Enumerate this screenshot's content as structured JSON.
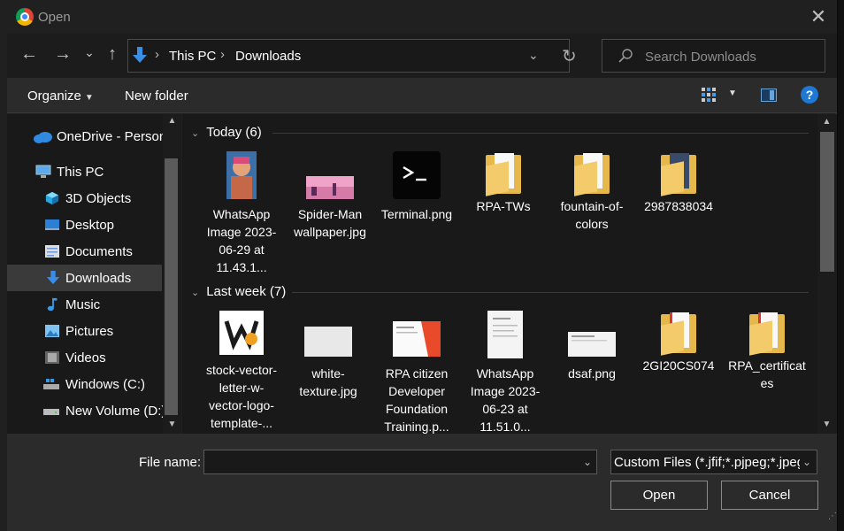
{
  "title_bar": {
    "title": "Open",
    "close_glyph": "✕"
  },
  "nav": {
    "back_glyph": "←",
    "forward_glyph": "→",
    "recent_glyph": "⌄",
    "up_glyph": "↑",
    "breadcrumb": [
      "This PC",
      "Downloads"
    ],
    "refresh_glyph": "↻",
    "search_placeholder": "Search Downloads"
  },
  "command_bar": {
    "organize": "Organize",
    "new_folder": "New folder",
    "help": "?"
  },
  "sidebar": {
    "items": [
      {
        "label": "OneDrive - Person",
        "icon": "cloud-icon"
      },
      {
        "label": "This PC",
        "icon": "computer-icon"
      },
      {
        "label": "3D Objects",
        "icon": "cube-icon"
      },
      {
        "label": "Desktop",
        "icon": "desktop-icon"
      },
      {
        "label": "Documents",
        "icon": "documents-icon"
      },
      {
        "label": "Downloads",
        "icon": "download-arrow-icon",
        "active": true
      },
      {
        "label": "Music",
        "icon": "music-note-icon"
      },
      {
        "label": "Pictures",
        "icon": "pictures-icon"
      },
      {
        "label": "Videos",
        "icon": "film-icon"
      },
      {
        "label": "Windows (C:)",
        "icon": "drive-windows-icon"
      },
      {
        "label": "New Volume (D:)",
        "icon": "drive-icon"
      }
    ]
  },
  "groups": [
    {
      "label": "Today (6)",
      "files": [
        {
          "label": "WhatsApp Image 2023-06-29 at 11.43.1...",
          "kind": "image-portrait"
        },
        {
          "label": "Spider-Man wallpaper.jpg",
          "kind": "image-landscape"
        },
        {
          "label": "Terminal.png",
          "kind": "terminal"
        },
        {
          "label": "RPA-TWs",
          "kind": "folder"
        },
        {
          "label": "fountain-of-colors",
          "kind": "folder"
        },
        {
          "label": "2987838034",
          "kind": "folder-photo"
        }
      ]
    },
    {
      "label": "Last week (7)",
      "files": [
        {
          "label": "stock-vector-letter-w-vector-logo-template-...",
          "kind": "logo"
        },
        {
          "label": "white-texture.jpg",
          "kind": "white"
        },
        {
          "label": "RPA citizen Developer Foundation Training.p...",
          "kind": "certificate"
        },
        {
          "label": "WhatsApp Image 2023-06-23 at 11.51.0...",
          "kind": "document"
        },
        {
          "label": "dsaf.png",
          "kind": "screenshot"
        },
        {
          "label": "2GI20CS074",
          "kind": "folder-pdf"
        },
        {
          "label": "RPA_certificates",
          "kind": "folder-pdf"
        }
      ]
    }
  ],
  "footer": {
    "file_name_label": "File name:",
    "file_name_value": "",
    "file_type": "Custom Files (*.jfif;*.pjpeg;*.jpeg;*.pjp;*.jpg)",
    "open_label": "Open",
    "cancel_label": "Cancel"
  }
}
